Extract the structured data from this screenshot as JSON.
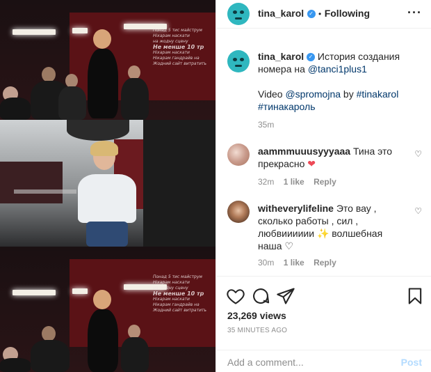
{
  "header": {
    "username": "tina_karol",
    "separator": "•",
    "follow_status": "Following",
    "more_label": "···"
  },
  "caption": {
    "username": "tina_karol",
    "text": "История создания номера на",
    "mention": "@tanci1plus1",
    "line2_prefix": "Video",
    "line2_mention": "@spromojna",
    "line2_by": "by",
    "hashtag1": "#tinakarol",
    "hashtag2": "#тинакароль",
    "time": "35m"
  },
  "comments": [
    {
      "username": "aammmuuusyyyaaa",
      "text": "Тина это прекрасно",
      "emoji": "❤",
      "time": "32m",
      "likes": "1 like",
      "reply": "Reply"
    },
    {
      "username": "witheverylifeline",
      "text": "Это вау , сколько работы , сил , любвииииии",
      "emoji": "✨",
      "text2": "волшебная наша",
      "emoji2": "♡",
      "time": "30m",
      "likes": "1 like",
      "reply": "Reply"
    }
  ],
  "stats": {
    "views": "23,269 views",
    "posted": "35 MINUTES AGO"
  },
  "add_comment": {
    "placeholder": "Add a comment...",
    "post_label": "Post"
  },
  "icons": {
    "like": "heart-icon",
    "comment": "comment-icon",
    "share": "share-icon",
    "save": "bookmark-icon"
  },
  "colors": {
    "verified": "#3897f0",
    "mention": "#00376b",
    "post_disabled": "#b3dbff",
    "heart_red": "#ed4956"
  },
  "media": {
    "overlay_text": [
      "Понад 5 тис майструм",
      "Ніхарам наскати",
      "на жодну сцену",
      "Не менше 10 тр",
      "Ніхарам наскати",
      "Нікарам гандрайв на",
      "Жодний сайт витратить"
    ]
  }
}
